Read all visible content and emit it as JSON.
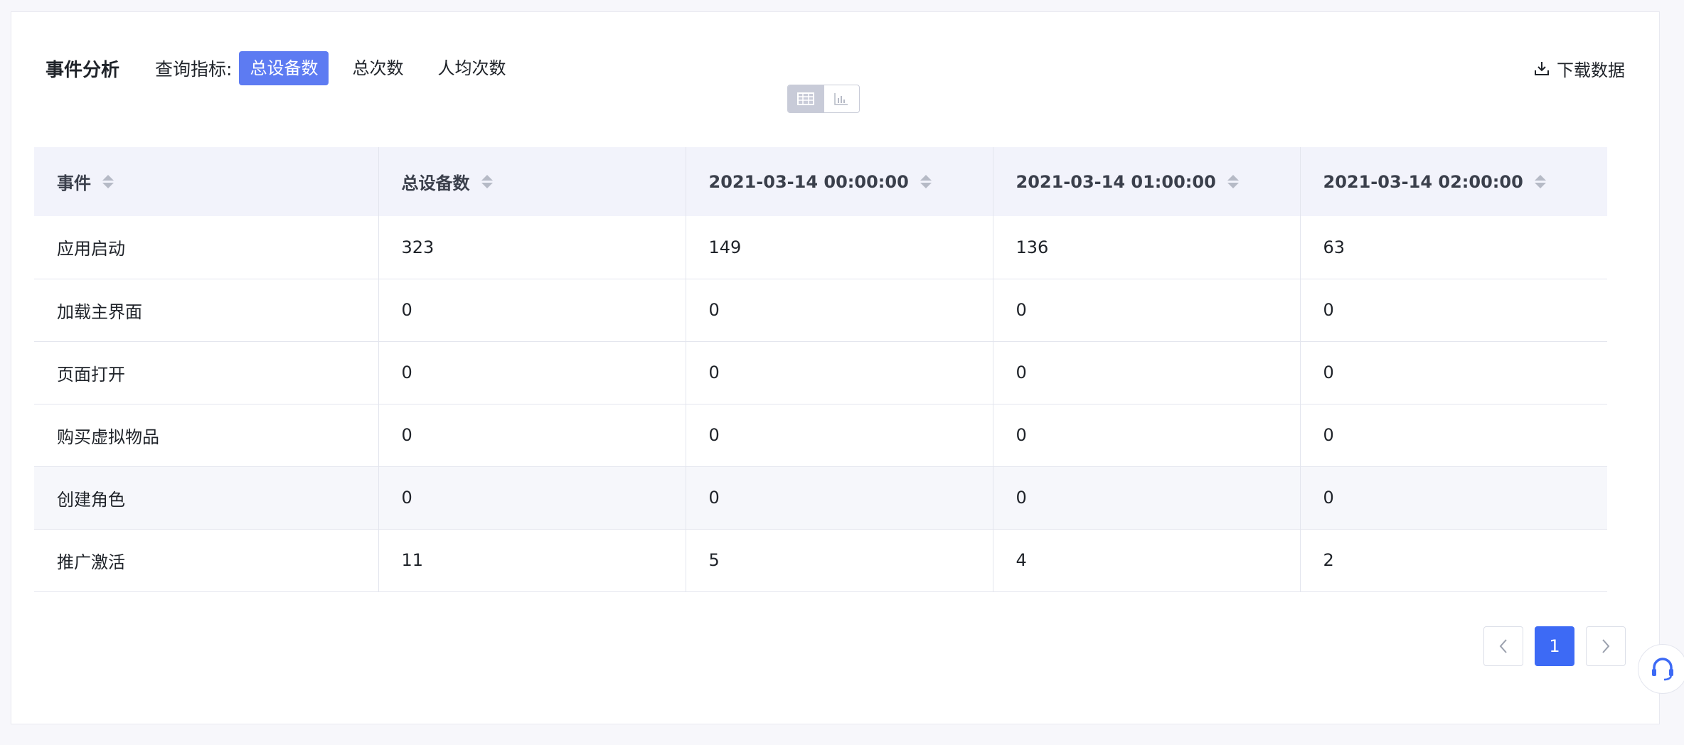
{
  "header": {
    "title": "事件分析",
    "metric_label": "查询指标:",
    "metric_tabs": [
      "总设备数",
      "总次数",
      "人均次数"
    ],
    "active_tab_index": 0,
    "download_label": "下载数据"
  },
  "view_switch": {
    "active": "table",
    "options": [
      "table-icon",
      "bar-chart-icon"
    ]
  },
  "table": {
    "columns": [
      "事件",
      "总设备数",
      "2021-03-14 00:00:00",
      "2021-03-14 01:00:00",
      "2021-03-14 02:00:00"
    ],
    "rows": [
      [
        "应用启动",
        "323",
        "149",
        "136",
        "63"
      ],
      [
        "加载主界面",
        "0",
        "0",
        "0",
        "0"
      ],
      [
        "页面打开",
        "0",
        "0",
        "0",
        "0"
      ],
      [
        "购买虚拟物品",
        "0",
        "0",
        "0",
        "0"
      ],
      [
        "创建角色",
        "0",
        "0",
        "0",
        "0"
      ],
      [
        "推广激活",
        "11",
        "5",
        "4",
        "2"
      ]
    ],
    "highlighted_row_index": 4
  },
  "pagination": {
    "prev": "<",
    "current": "1",
    "next": ">"
  },
  "colors": {
    "accent": "#5d7bf2",
    "pager_active": "#3d6af5"
  }
}
